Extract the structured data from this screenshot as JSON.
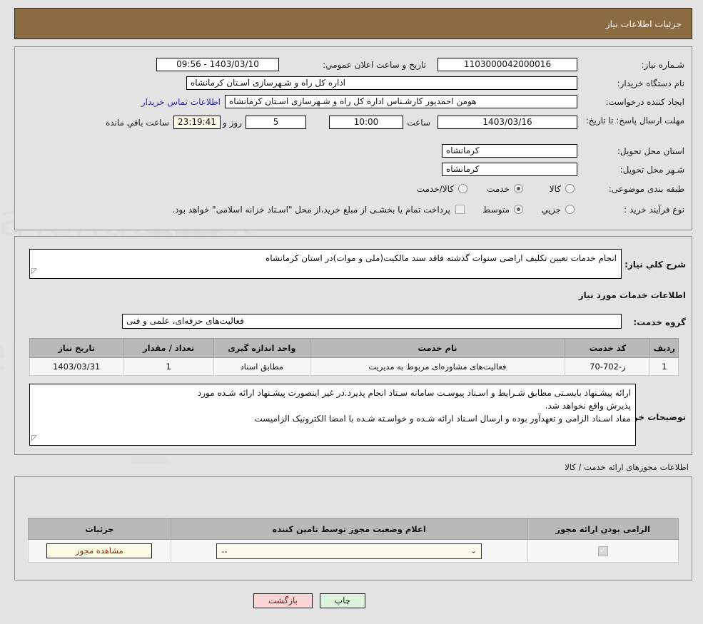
{
  "header": {
    "title": "جزئیات اطلاعات نیاز"
  },
  "top_form": {
    "labels": {
      "need_number": "شـماره نیاز:",
      "buyer_org": "نام دستگاه خریدار:",
      "request_creator": "ایجاد کننده درخواست:",
      "deadline": "مهلت ارسال پاسخ: تا تاریخ:",
      "delivery_province": "استان محل تحویل:",
      "delivery_city": "شـهر محل تحویل:",
      "category": "طبقه بندی موضوعی:",
      "purchase_type": "نوع فرآیند خرید :",
      "public_announce": "تاریخ و ساعت اعلان عمومي:",
      "hour": "ساعت",
      "day_and": "روز و",
      "hours_remaining": "ساعت باقي مانده"
    },
    "values": {
      "need_number": "1103000042000016",
      "buyer_org": "اداره کل راه و شـهرسازی اسـتان کرمانشاه",
      "request_creator": "هومن احمدپور کارشـناس اداره کل راه و شـهرسازی اسـتان کرمانشاه",
      "deadline_date": "1403/03/16",
      "deadline_time": "10:00",
      "days_remaining": "5",
      "time_remaining": "23:19:41",
      "delivery_province": "کرمانشاه",
      "delivery_city": "کرمانشاه",
      "public_announce": "1403/03/10 - 09:56"
    },
    "buyer_contact_link": "اطلاعات تماس خریدار",
    "category_options": [
      {
        "label": "کالا",
        "selected": false
      },
      {
        "label": "خدمت",
        "selected": true
      },
      {
        "label": "کالا/خدمت",
        "selected": false
      }
    ],
    "purchase_options": [
      {
        "label": "جزیي",
        "selected": false
      },
      {
        "label": "متوسط",
        "selected": true
      }
    ],
    "treasury_checkbox": {
      "checked": false,
      "text": "پرداخت تمام یا بخشـی از مبلغ خرید،از محل \"اسـناد خزانه اسلامی\" خواهد بود."
    }
  },
  "middle": {
    "need_description_label": "شرح کلي نیاز:",
    "need_description": "انجام خدمات تعیین تکلیف اراضی سنوات گذشته فاقد سند مالکیت(ملی و موات)در استان کرمانشاه",
    "services_info_heading": "اطلاعات خدمات مورد نیاز",
    "service_group_label": "گروه خدمت:",
    "service_group": "فعالیت‌های حرفه‌ای، علمی و فنی",
    "table": {
      "headers": [
        "ردیف",
        "کد خدمت",
        "نام خدمت",
        "واحد اندازه گیری",
        "تعداد / مقدار",
        "تاریخ نیاز"
      ],
      "rows": [
        [
          "1",
          "ز-702-70",
          "فعالیت‌های مشاوره‌ای مربوط به مدیریت",
          "مطابق اسناد",
          "1",
          "1403/03/31"
        ]
      ]
    },
    "buyer_notes_label": "توضیحات خریدار:",
    "buyer_notes_line1": "ارائه پیشـنهاد بایسـتی مطابق شـرایط و اسـناد پیوسـت سامانه سـتاد انجام پذیرد.در غیر اینصورت پیشـنهاد ارائه شـده مورد",
    "buyer_notes_line2": "پذیرش واقع نخواهد شد.",
    "buyer_notes_line3": "مفاد اسـناد الزامی و تعهدآور بوده و ارسال اسـناد ارائه شـده و خواسـته شـده با امضا الکترونیک الزامیست"
  },
  "permits": {
    "section_caption": "اطلاعات مجوزهای ارائه خدمت / کالا",
    "headers": [
      "الزامی بودن ارائه مجوز",
      "اعلام وضعیت مجوز توسط تامین کننده",
      "جزئیات"
    ],
    "row": {
      "required_checked": true,
      "status_value": "--",
      "details_button": "مشاهده مجوز"
    }
  },
  "footer": {
    "print_button": "چاپ",
    "back_button": "بازگشت"
  },
  "watermark": {
    "text": "AnaTender.net"
  }
}
